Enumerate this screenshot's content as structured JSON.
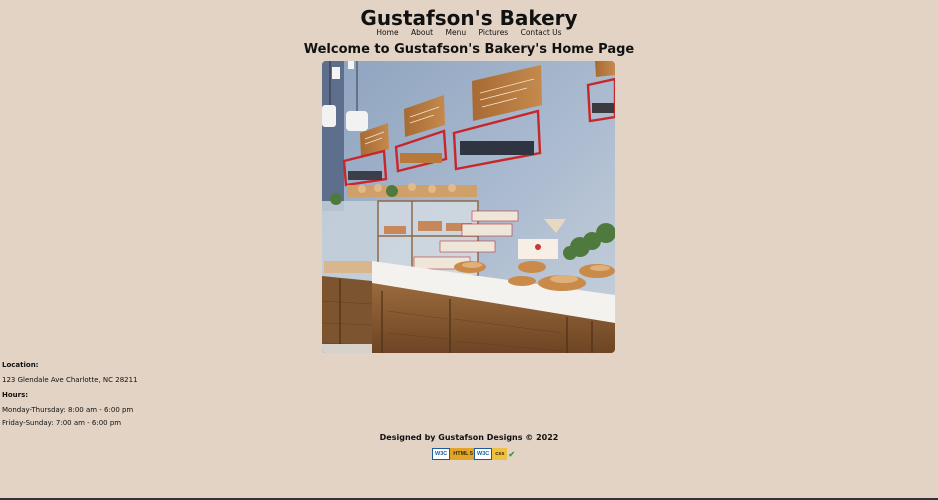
{
  "header": {
    "title": "Gustafson's Bakery"
  },
  "nav": {
    "items": [
      {
        "label": "Home"
      },
      {
        "label": "About"
      },
      {
        "label": "Menu"
      },
      {
        "label": "Pictures"
      },
      {
        "label": "Contact Us"
      }
    ]
  },
  "main": {
    "welcome": "Welcome to Gustafson's Bakery's Home Page"
  },
  "info": {
    "location_heading": "Location:",
    "address": "123 Glendale Ave Charlotte, NC 28211",
    "hours_heading": "Hours:",
    "weekday_hours": "Monday-Thursday: 8:00 am - 6:00 pm",
    "weekend_hours": "Friday-Sunday: 7:00 am - 6:00 pm"
  },
  "footer": {
    "credit": "Designed by Gustafson Designs © 2022",
    "badges": [
      {
        "w3c": "W3C",
        "label": "HTML 5",
        "icon": "html5-valid-badge-icon"
      },
      {
        "w3c": "W3C",
        "label": "css",
        "icon": "css-valid-badge-icon"
      }
    ]
  },
  "colors": {
    "background": "#e2d3c5",
    "text": "#111111"
  }
}
